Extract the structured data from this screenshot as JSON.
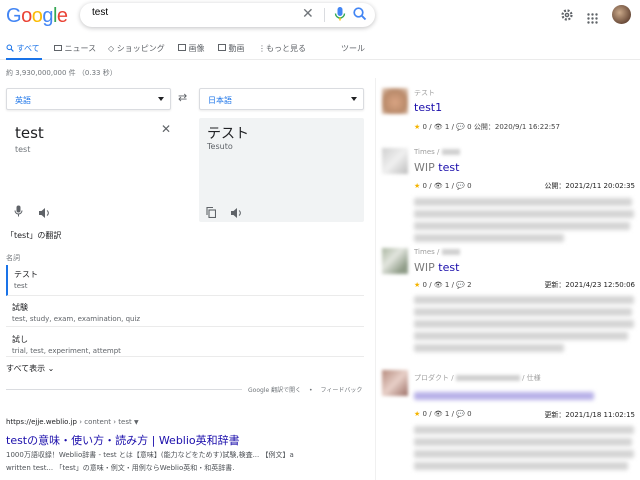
{
  "logo": "Google",
  "search": {
    "query": "test"
  },
  "tabs": [
    "すべて",
    "ニュース",
    "ショッピング",
    "画像",
    "動画",
    "もっと見る",
    "ツール"
  ],
  "stats": "約 3,930,000,000 件 （0.33 秒）",
  "translate": {
    "source_lang": "英語",
    "target_lang": "日本語",
    "source_word": "test",
    "source_pron": "test",
    "target_word": "テスト",
    "target_pron": "Tesuto",
    "heading": "「test」の翻訳",
    "pos": "名詞",
    "rows": [
      {
        "word": "テスト",
        "syn": "test"
      },
      {
        "word": "試験",
        "syn": "test, study, exam, examination, quiz"
      },
      {
        "word": "試し",
        "syn": "trial, test, experiment, attempt"
      }
    ],
    "show_all": "すべて表示",
    "open_link": "Google 翻訳で開く",
    "dot": "•",
    "feedback": "フィードバック"
  },
  "result": {
    "url": "https://ejje.weblio.jp",
    "breadcrumb": " › content › test",
    "title": "testの意味・使い方・読み方 | Weblio英和辞書",
    "snippet1": "1000万語収録！Weblio辞書 - test とは【意味】(能力などをためす)試験,検査... 【例文】a",
    "snippet2": "written test... 「test」の意味・例文・用例ならWeblio英和・和英辞書."
  },
  "cards": [
    {
      "category": "テスト",
      "title": "test1",
      "wip": "",
      "stars": "0",
      "views": "1",
      "comments": "0",
      "date": "公開：2020/9/1 16:22:57"
    },
    {
      "category": "Times /",
      "title": "test",
      "wip": "WIP ",
      "stars": "0",
      "views": "1",
      "comments": "0",
      "date": "公開：2021/2/11 20:02:35"
    },
    {
      "category": "Times /",
      "title": "test",
      "wip": "WIP ",
      "stars": "0",
      "views": "1",
      "comments": "2",
      "date": "更新：2021/4/23 12:50:06"
    },
    {
      "category": "プロダクト /",
      "category_suffix": "/ 仕様",
      "title": "",
      "wip": "",
      "stars": "0",
      "views": "1",
      "comments": "0",
      "date": "更新：2021/1/18 11:02:15"
    }
  ],
  "colors": {
    "accent": "#1a73e8",
    "link": "#1a0dab",
    "text": "#202124",
    "muted": "#70757a"
  }
}
